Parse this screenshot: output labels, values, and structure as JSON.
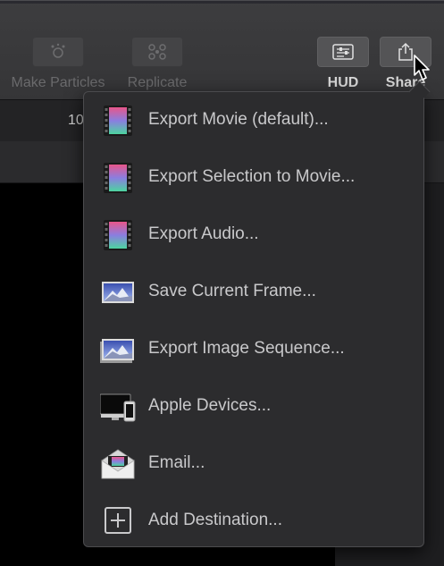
{
  "toolbar": {
    "make_particles_label": "Make Particles",
    "replicate_label": "Replicate",
    "hud_label": "HUD",
    "share_label": "Share"
  },
  "ruler": {
    "frame_number": "10"
  },
  "share_menu": {
    "items": [
      {
        "label": "Export Movie (default)...",
        "icon": "filmstrip-icon"
      },
      {
        "label": "Export Selection to Movie...",
        "icon": "filmstrip-icon"
      },
      {
        "label": "Export Audio...",
        "icon": "filmstrip-icon"
      },
      {
        "label": "Save Current Frame...",
        "icon": "mountain-image-icon"
      },
      {
        "label": "Export Image Sequence...",
        "icon": "stacked-images-icon"
      },
      {
        "label": "Apple Devices...",
        "icon": "apple-devices-icon"
      },
      {
        "label": "Email...",
        "icon": "envelope-icon"
      },
      {
        "label": "Add Destination...",
        "icon": "plus-box-icon"
      }
    ]
  },
  "colors": {
    "toolbar_bg": "#3a3a3c",
    "menu_bg": "#2c2c2e",
    "menu_text": "#c9c9cb",
    "disabled_text": "#6a6a6c"
  }
}
